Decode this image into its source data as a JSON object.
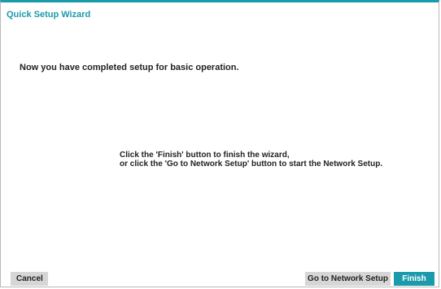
{
  "window": {
    "title": "Quick Setup Wizard"
  },
  "main": {
    "completed_message": "Now you have completed setup for basic operation.",
    "instruction_line1": "Click the 'Finish' button to finish the wizard,",
    "instruction_line2": "or click the 'Go to Network Setup' button to start the Network Setup."
  },
  "buttons": {
    "cancel": "Cancel",
    "network_setup": "Go to Network Setup",
    "finish": "Finish"
  },
  "colors": {
    "accent": "#1a9bab",
    "button_gray": "#d6d6d6"
  }
}
